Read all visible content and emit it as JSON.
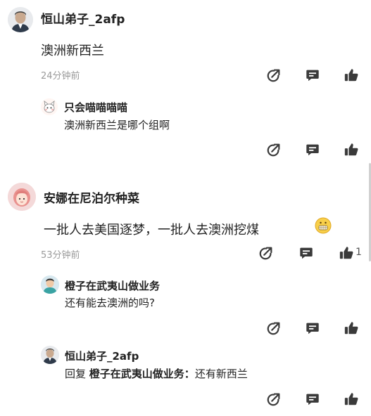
{
  "comments": [
    {
      "user": "恒山弟子_2afp",
      "text": "澳洲新西兰",
      "time": "24分钟前"
    },
    {
      "user": "只会喵喵喵喵",
      "text": "澳洲新西兰是哪个组啊"
    },
    {
      "user": "安娜在尼泊尔种菜",
      "text": "一批人去美国逐梦，一批人去澳洲挖煤",
      "time": "53分钟前",
      "like_count": "1"
    },
    {
      "user": "橙子在武夷山做业务",
      "text": "还有能去澳洲的吗?"
    },
    {
      "user": "恒山弟子_2afp",
      "reply_prefix": "回复",
      "reply_to": "橙子在武夷山做业务：",
      "reply_text": "还有新西兰"
    }
  ],
  "icons": {
    "share": "share-arrow-icon",
    "comment": "comment-bubble-icon",
    "like": "thumbs-up-icon",
    "emoji": "grimace-emoji-icon"
  },
  "colors": {
    "text": "#222222",
    "muted": "#9a9a9a",
    "icon": "#3a3a3a"
  }
}
